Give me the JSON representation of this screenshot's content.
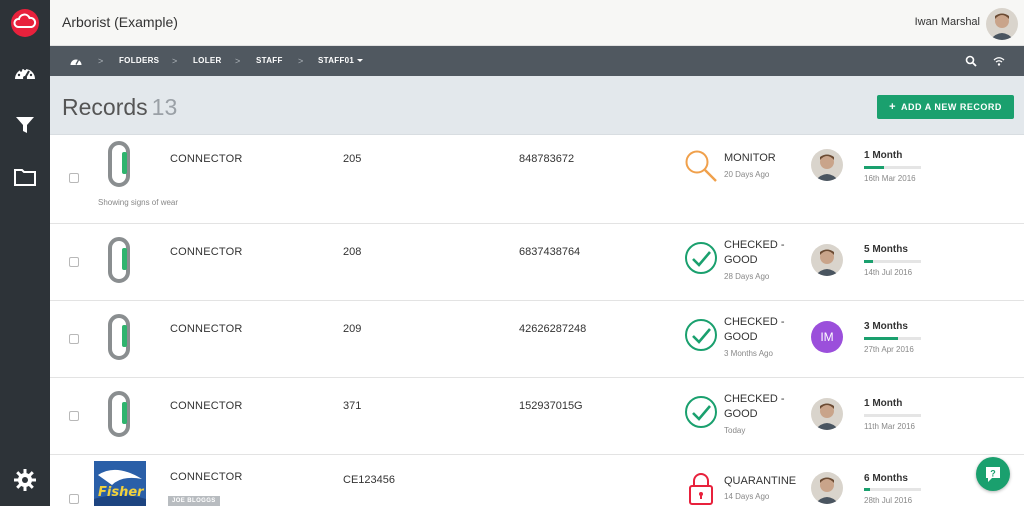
{
  "header": {
    "app_title": "Arborist (Example)",
    "user_name": "Iwan Marshal"
  },
  "breadcrumb": [
    {
      "label": ">"
    },
    {
      "label": "FOLDERS"
    },
    {
      "label": ">"
    },
    {
      "label": "LOLER"
    },
    {
      "label": ">"
    },
    {
      "label": "STAFF"
    },
    {
      "label": ">"
    },
    {
      "label": "STAFF01"
    }
  ],
  "page": {
    "title": "Records",
    "count": "13",
    "add_label": "ADD A NEW RECORD",
    "add_plus": "+"
  },
  "colors": {
    "sidebar": "#2d3338",
    "accent": "#1aa06e",
    "brand_red": "#e8213c",
    "monitor": "#f0a04b",
    "check": "#1aa06e",
    "quarantine": "#e8213c",
    "initials_bg": "#9b4fdb"
  },
  "records": [
    {
      "name": "CONNECTOR",
      "note": "Showing signs of wear",
      "code": "205",
      "serial": "848783672",
      "status": "MONITOR",
      "status_icon": "magnifier-icon",
      "ago": "20 Days Ago",
      "interval": "1 Month",
      "progress": 0.35,
      "date": "16th Mar 2016"
    },
    {
      "name": "CONNECTOR",
      "code": "208",
      "serial": "6837438764",
      "status_line1": "CHECKED -",
      "status_line2": "GOOD",
      "status_icon": "check-circle-icon",
      "ago": "28 Days Ago",
      "interval": "5 Months",
      "progress": 0.15,
      "date": "14th Jul 2016"
    },
    {
      "name": "CONNECTOR",
      "code": "209",
      "serial": "42626287248",
      "status_line1": "CHECKED -",
      "status_line2": "GOOD",
      "status_icon": "check-circle-icon",
      "ago": "3 Months Ago",
      "initials": "IM",
      "interval": "3 Months",
      "progress": 0.6,
      "date": "27th Apr 2016"
    },
    {
      "name": "CONNECTOR",
      "code": "371",
      "serial": "152937015G",
      "status_line1": "CHECKED -",
      "status_line2": "GOOD",
      "status_icon": "check-circle-icon",
      "ago": "Today",
      "interval": "1 Month",
      "progress": 0.0,
      "date": "11th Mar 2016"
    },
    {
      "name": "CONNECTOR",
      "tag": "JOE BLOGGS",
      "code": "CE123456",
      "status": "QUARANTINE",
      "status_icon": "padlock-icon",
      "ago": "14 Days Ago",
      "interval": "6 Months",
      "progress": 0.1,
      "date": "28th Jul 2016",
      "thumb_text": "Fisher"
    }
  ]
}
